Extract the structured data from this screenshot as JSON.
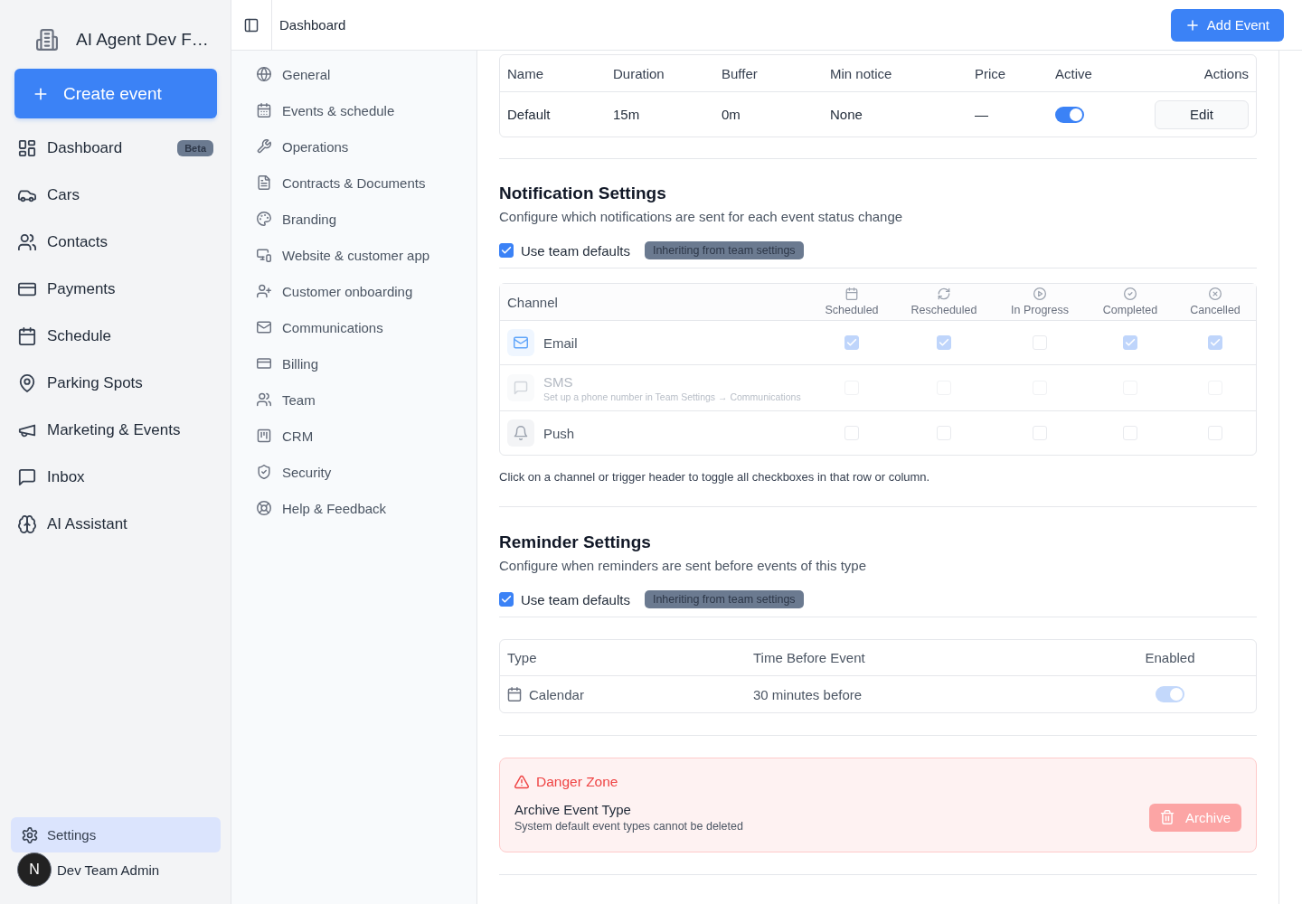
{
  "sidebar": {
    "org_name": "AI Agent Dev F…",
    "create_button": "Create event",
    "items": [
      {
        "label": "Dashboard",
        "badge": "Beta",
        "selected": false
      },
      {
        "label": "Cars",
        "selected": false
      },
      {
        "label": "Contacts",
        "selected": false
      },
      {
        "label": "Payments",
        "selected": false
      },
      {
        "label": "Schedule",
        "selected": false
      },
      {
        "label": "Parking Spots",
        "selected": false
      },
      {
        "label": "Marketing & Events",
        "selected": false
      },
      {
        "label": "Inbox",
        "selected": false
      },
      {
        "label": "AI Assistant",
        "selected": false
      }
    ],
    "settings_item": {
      "label": "Settings",
      "selected": true
    },
    "user": {
      "initial": "N",
      "name": "Dev Team Admin"
    }
  },
  "top_bar": {
    "breadcrumb": "Dashboard",
    "add_button": "Add Event"
  },
  "settings_nav": {
    "items": [
      {
        "label": "General",
        "selected": false
      },
      {
        "label": "Events & schedule",
        "selected": false
      },
      {
        "label": "Operations",
        "selected": false
      },
      {
        "label": "Contracts & Documents",
        "selected": false
      },
      {
        "label": "Branding",
        "selected": false
      },
      {
        "label": "Website & customer app",
        "selected": false
      },
      {
        "label": "Customer onboarding",
        "selected": false
      },
      {
        "label": "Communications",
        "selected": false
      },
      {
        "label": "Billing",
        "selected": false
      },
      {
        "label": "Team",
        "selected": false
      },
      {
        "label": "CRM",
        "selected": false
      },
      {
        "label": "Security",
        "selected": false
      },
      {
        "label": "Help & Feedback",
        "selected": false
      }
    ]
  },
  "event_table": {
    "columns": [
      "Name",
      "Duration",
      "Buffer",
      "Min notice",
      "Price",
      "Active",
      "Actions"
    ],
    "rows": [
      {
        "cells": [
          "Default",
          "15m",
          "0m",
          "None",
          "—"
        ],
        "active": true,
        "action": "Edit"
      }
    ]
  },
  "notification_settings": {
    "title": "Notification Settings",
    "description": "Configure which notifications are sent for each event status change",
    "use_team_defaults": {
      "label": "Use team defaults",
      "checked": true
    },
    "badge": "Inheriting from team settings",
    "matrix": {
      "channel_header": "Channel",
      "triggers": [
        "Scheduled",
        "Rescheduled",
        "In Progress",
        "Completed",
        "Cancelled"
      ],
      "channels": [
        {
          "name": "Email",
          "disabled": false,
          "cells": [
            {
              "checked": true
            },
            {
              "checked": true
            },
            {
              "checked": false
            },
            {
              "checked": true
            },
            {
              "checked": true
            }
          ]
        },
        {
          "name": "SMS",
          "hint": "Set up a phone number in Team Settings → Communications",
          "disabled": true,
          "cells": [
            {
              "checked": false
            },
            {
              "checked": false
            },
            {
              "checked": false
            },
            {
              "checked": false
            },
            {
              "checked": false
            }
          ]
        },
        {
          "name": "Push",
          "disabled": false,
          "cells": [
            {
              "checked": false
            },
            {
              "checked": false
            },
            {
              "checked": false
            },
            {
              "checked": false
            },
            {
              "checked": false
            }
          ]
        }
      ]
    },
    "footnote": "Click on a channel or trigger header to toggle all checkboxes in that row or column."
  },
  "reminder_settings": {
    "title": "Reminder Settings",
    "description": "Configure when reminders are sent before events of this type",
    "use_team_defaults": {
      "label": "Use team defaults",
      "checked": true
    },
    "badge": "Inheriting from team settings",
    "table": {
      "columns": [
        "Type",
        "Time Before Event",
        "Enabled"
      ],
      "rows": [
        {
          "type": "Calendar",
          "time": "30 minutes before",
          "enabled": true
        }
      ]
    }
  },
  "danger_zone": {
    "title": "Danger Zone",
    "item_title": "Archive Event Type",
    "item_description": "System default event types cannot be deleted",
    "button": {
      "label": "Archive",
      "disabled": true
    }
  }
}
